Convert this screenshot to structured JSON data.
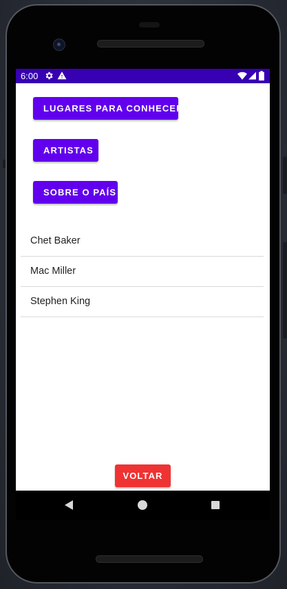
{
  "statusbar": {
    "time": "6:00",
    "icons": [
      "gear-icon",
      "warning-icon",
      "wifi-icon",
      "signal-icon",
      "battery-icon"
    ],
    "background_color": "#3700b3"
  },
  "main": {
    "buttons": {
      "places": "LUGARES PARA CONHECER",
      "artists": "ARTISTAS",
      "about_country": "SOBRE O PAÍS"
    },
    "list": [
      "Chet Baker",
      "Mac Miller",
      "Stephen King"
    ],
    "back_button": "VOLTAR"
  },
  "colors": {
    "primary_button": "#6200ee",
    "back_button": "#ef3333"
  },
  "navbar": {
    "icons": [
      "back-icon",
      "home-icon",
      "recents-icon"
    ]
  }
}
